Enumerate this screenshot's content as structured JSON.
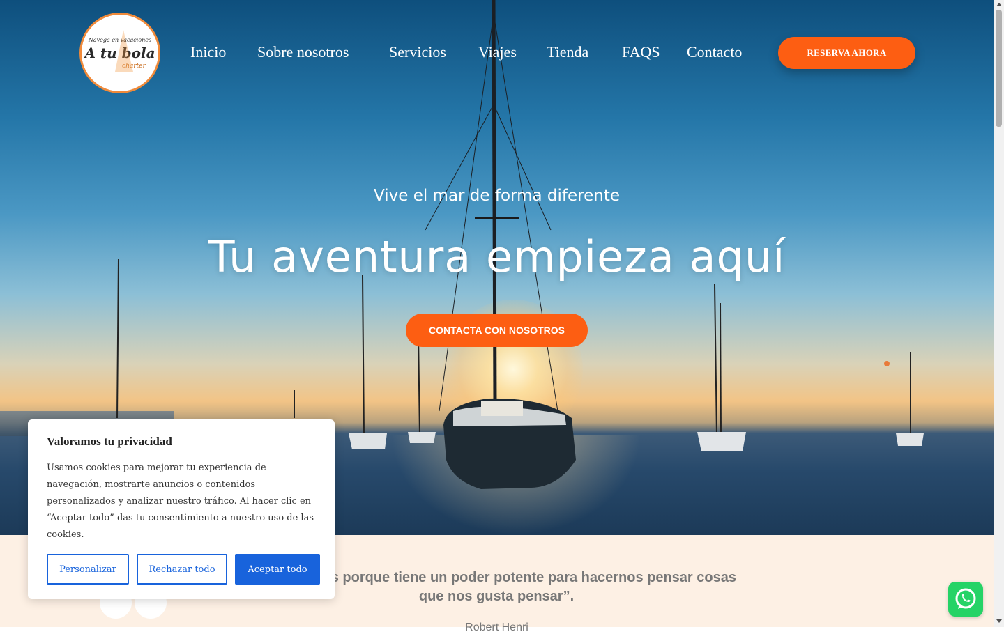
{
  "header": {
    "logo": {
      "line1": "Navega en vacaciones",
      "line2": "A tu bola",
      "line3": "charter"
    },
    "nav": [
      {
        "label": "Inicio"
      },
      {
        "label": "Sobre nosotros"
      },
      {
        "label": "Servicios"
      },
      {
        "label": "Viajes"
      },
      {
        "label": "Tienda"
      },
      {
        "label": "FAQS"
      },
      {
        "label": "Contacto"
      }
    ],
    "cta_label": "RESERVA AHORA"
  },
  "hero": {
    "subtitle": "Vive el mar de forma diferente",
    "title": "Tu aventura empieza aquí",
    "cta_label": "CONTACTA CON NOSOTROS"
  },
  "quote": {
    "text": "s el mar? Es porque tiene un poder potente para hacernos pensar cosas que nos gusta pensar”.",
    "author": "Robert Henri"
  },
  "cookie": {
    "title": "Valoramos tu privacidad",
    "body": "Usamos cookies para mejorar tu experiencia de navegación, mostrarte anuncios o contenidos personalizados y analizar nuestro tráfico. Al hacer clic en “Aceptar todo”  das tu consentimiento a nuestro uso de las cookies.",
    "customize_label": "Personalizar",
    "reject_label": "Rechazar todo",
    "accept_label": "Aceptar todo"
  },
  "colors": {
    "accent": "#fd5e12",
    "cookie_blue": "#1863dc",
    "quote_bg": "#fdf0e4",
    "whatsapp": "#25d366"
  },
  "icons": {
    "whatsapp": "whatsapp-icon"
  }
}
